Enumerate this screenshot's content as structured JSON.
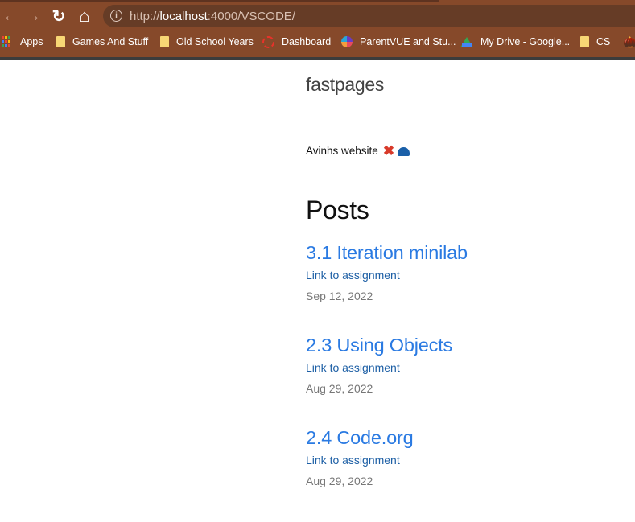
{
  "browser": {
    "url_prefix": "http://",
    "url_host": "localhost",
    "url_rest": ":4000/VSCODE/",
    "back_icon": "←",
    "forward_icon": "→",
    "reload_icon": "↻",
    "home_icon": "⌂",
    "info_icon": "i",
    "bookmarks": [
      {
        "label": "Apps",
        "icon": "apps-grid-icon"
      },
      {
        "label": "Games And Stuff",
        "icon": "folder-icon"
      },
      {
        "label": "Old School Years",
        "icon": "folder-icon"
      },
      {
        "label": "Dashboard",
        "icon": "dashboard-icon"
      },
      {
        "label": "ParentVUE and Stu...",
        "icon": "parentvue-icon"
      },
      {
        "label": "My Drive - Google...",
        "icon": "google-drive-icon"
      },
      {
        "label": "CS",
        "icon": "folder-icon"
      },
      {
        "label": "",
        "icon": "acorn-icon"
      }
    ]
  },
  "site": {
    "title": "fastpages",
    "intro": "Avinhs website",
    "intro_emoji_x": "✖",
    "posts_heading": "Posts",
    "posts": [
      {
        "title": "3.1 Iteration minilab",
        "description": "Link to assignment",
        "date": "Sep 12, 2022"
      },
      {
        "title": "2.3 Using Objects",
        "description": "Link to assignment",
        "date": "Aug 29, 2022"
      },
      {
        "title": "2.4 Code.org",
        "description": "Link to assignment",
        "date": "Aug 29, 2022"
      }
    ]
  },
  "colors": {
    "chrome": "#86492a",
    "omnibox": "#663c26",
    "link": "#2a7ae2",
    "date": "#777777"
  }
}
